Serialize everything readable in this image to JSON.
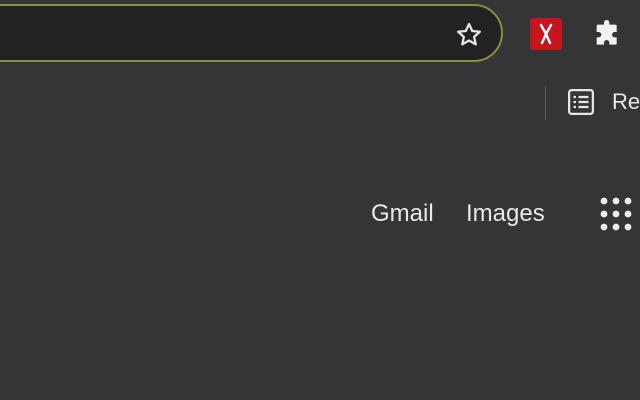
{
  "toolbar": {
    "bookmark_star_icon": "star-icon",
    "extension_icon": "red-extension-icon",
    "extensions_icon": "puzzle-icon",
    "omnibox_border_color": "#8a8d3a",
    "extension_color": "#c4161c"
  },
  "bookmarks_bar": {
    "reading_list_icon": "reading-list-icon",
    "reading_list_label": "Re"
  },
  "google_header": {
    "gmail_label": "Gmail",
    "images_label": "Images",
    "apps_icon": "apps-grid-icon"
  }
}
